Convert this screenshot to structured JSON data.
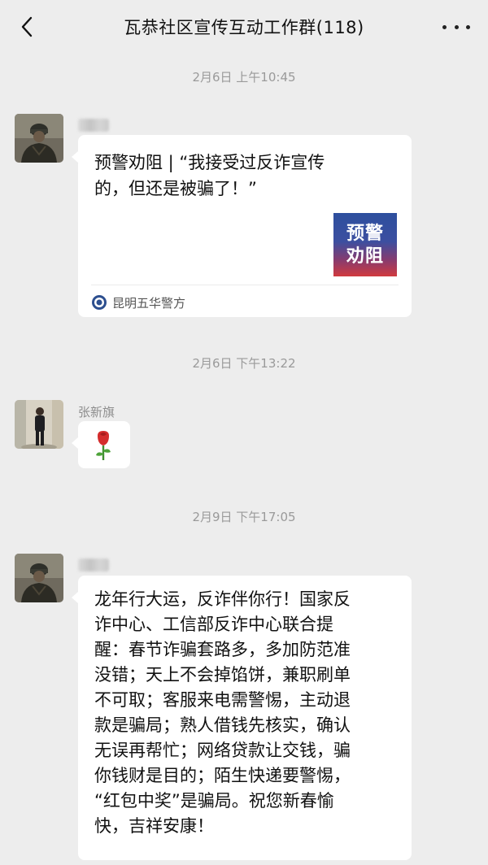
{
  "header": {
    "title": "瓦恭社区宣传互动工作群(118)",
    "back_icon": "chevron-left-icon",
    "more_icon": "more-dots-icon"
  },
  "messages": [
    {
      "time": "2月6日 上午10:45",
      "sender": "",
      "type": "card",
      "card": {
        "text": "预警劝阻 | “我接受过反诈宣传的，但还是被骗了！”",
        "thumb_lines": [
          "预警",
          "劝阻"
        ],
        "source": "昆明五华警方",
        "source_icon": "police-badge-icon"
      }
    },
    {
      "time": "2月6日 下午13:22",
      "sender": "张新旗",
      "type": "emoji",
      "emoji": "🌹"
    },
    {
      "time": "2月9日 下午17:05",
      "sender": "",
      "type": "text",
      "text": "龙年行大运，反诈伴你行！国家反\n诈中心、工信部反诈中心联合提\n醒：春节诈骗套路多，多加防范准\n没错；天上不会掉馅饼，兼职刷单\n不可取；客服来电需警惕，主动退\n款是骗局；熟人借钱先核实，确认\n无误再帮忙；网络贷款让交钱，骗\n你钱财是目的；陌生快递要警惕，\n“红包中奖”是骗局。祝您新春愉\n快，吉祥安康！"
    }
  ]
}
